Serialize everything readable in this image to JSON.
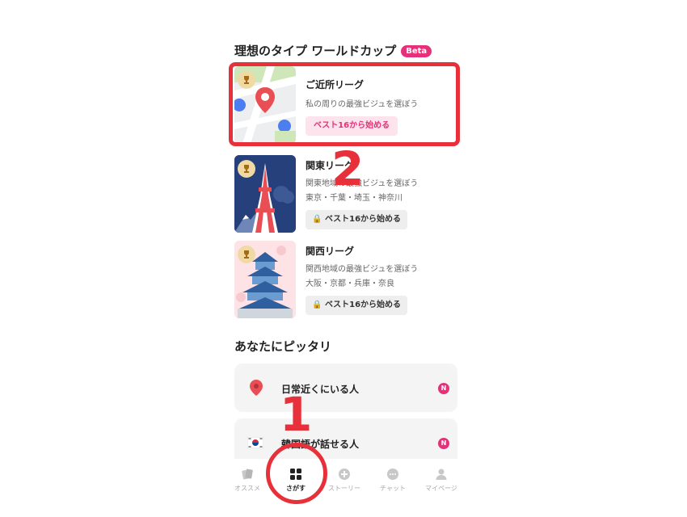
{
  "worldcup": {
    "title": "理想のタイプ ワールドカップ",
    "badge": "Beta",
    "leagues": [
      {
        "title": "ご近所リーグ",
        "subtitle": "私の周りの最強ビジュを選ぼう",
        "areas": "",
        "button": "ベスト16から始める",
        "locked": false
      },
      {
        "title": "関東リーグ",
        "subtitle": "関東地域の最強ビジュを選ぼう",
        "areas": "東京・千葉・埼玉・神奈川",
        "button": "ベスト16から始める",
        "locked": true
      },
      {
        "title": "関西リーグ",
        "subtitle": "関西地域の最強ビジュを選ぼう",
        "areas": "大阪・京都・兵庫・奈良",
        "button": "ベスト16から始める",
        "locked": true
      }
    ]
  },
  "recommend": {
    "title": "あなたにピッタリ",
    "items": [
      {
        "label": "日常近くにいる人",
        "icon": "location-pin-icon",
        "badge": "N"
      },
      {
        "label": "韓国語が話せる人",
        "icon": "korea-flag-icon",
        "badge": "N"
      }
    ]
  },
  "tabbar": {
    "tabs": [
      {
        "label": "オススメ",
        "icon": "cards-icon",
        "active": false
      },
      {
        "label": "さがす",
        "icon": "grid-icon",
        "active": true
      },
      {
        "label": "ストーリー",
        "icon": "plus-circle-icon",
        "active": false
      },
      {
        "label": "チャット",
        "icon": "chat-bubble-icon",
        "active": false
      },
      {
        "label": "マイページ",
        "icon": "person-icon",
        "active": false
      }
    ]
  },
  "annotations": {
    "step1": "1",
    "step2": "2"
  },
  "colors": {
    "accent": "#e6307a",
    "annotation": "#e8303a"
  }
}
